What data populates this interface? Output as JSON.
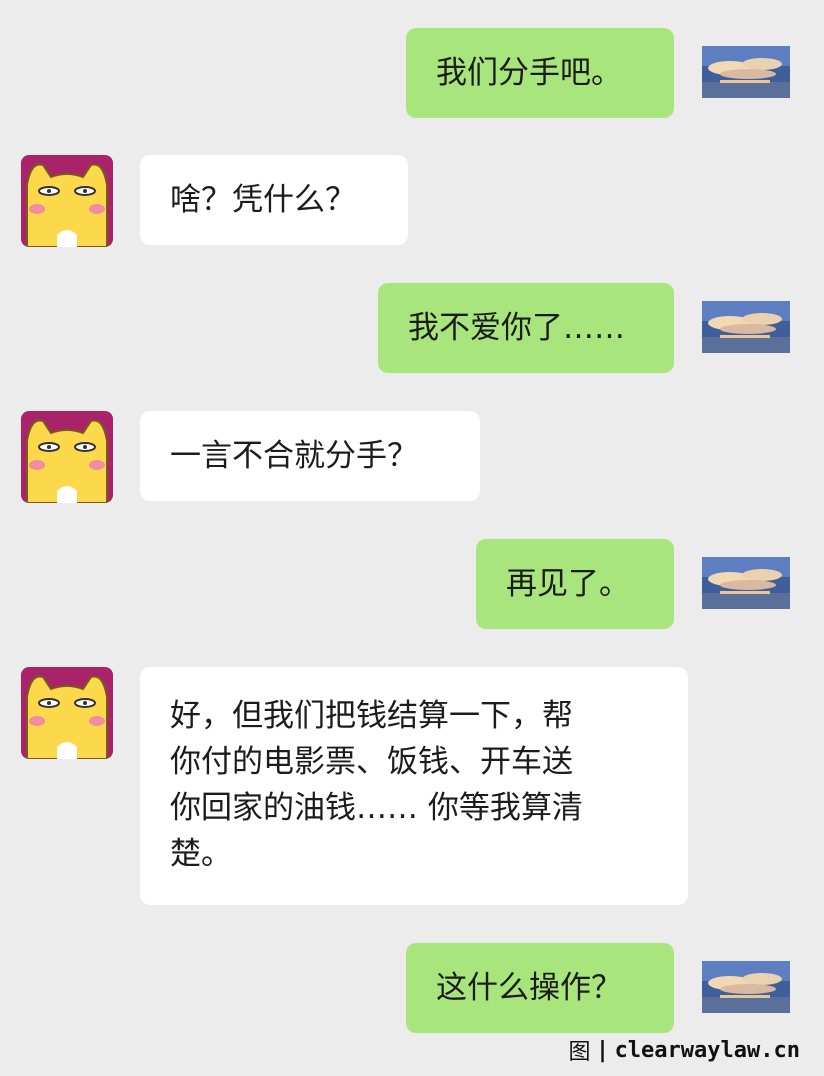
{
  "messages": [
    {
      "from": "me",
      "text": "我们分手吧。"
    },
    {
      "from": "them",
      "text": "啥？凭什么？"
    },
    {
      "from": "me",
      "text": "我不爱你了……"
    },
    {
      "from": "them",
      "text": "一言不合就分手？"
    },
    {
      "from": "me",
      "text": "再见了。"
    },
    {
      "from": "them",
      "text": "好，但我们把钱结算一下，帮\n你付的电影票、饭钱、开车送\n你回家的油钱…… 你等我算清\n楚。"
    },
    {
      "from": "me",
      "text": "这什么操作？"
    }
  ],
  "footer": {
    "prefix": "图",
    "separator": "|",
    "site": "clearwaylaw.cn"
  },
  "colors": {
    "background": "#ececec",
    "my_bubble": "#a9e57d",
    "their_bubble": "#ffffff"
  },
  "icons": {
    "me_avatar": "sky-clouds-avatar",
    "them_avatar": "yellow-cat-avatar"
  }
}
